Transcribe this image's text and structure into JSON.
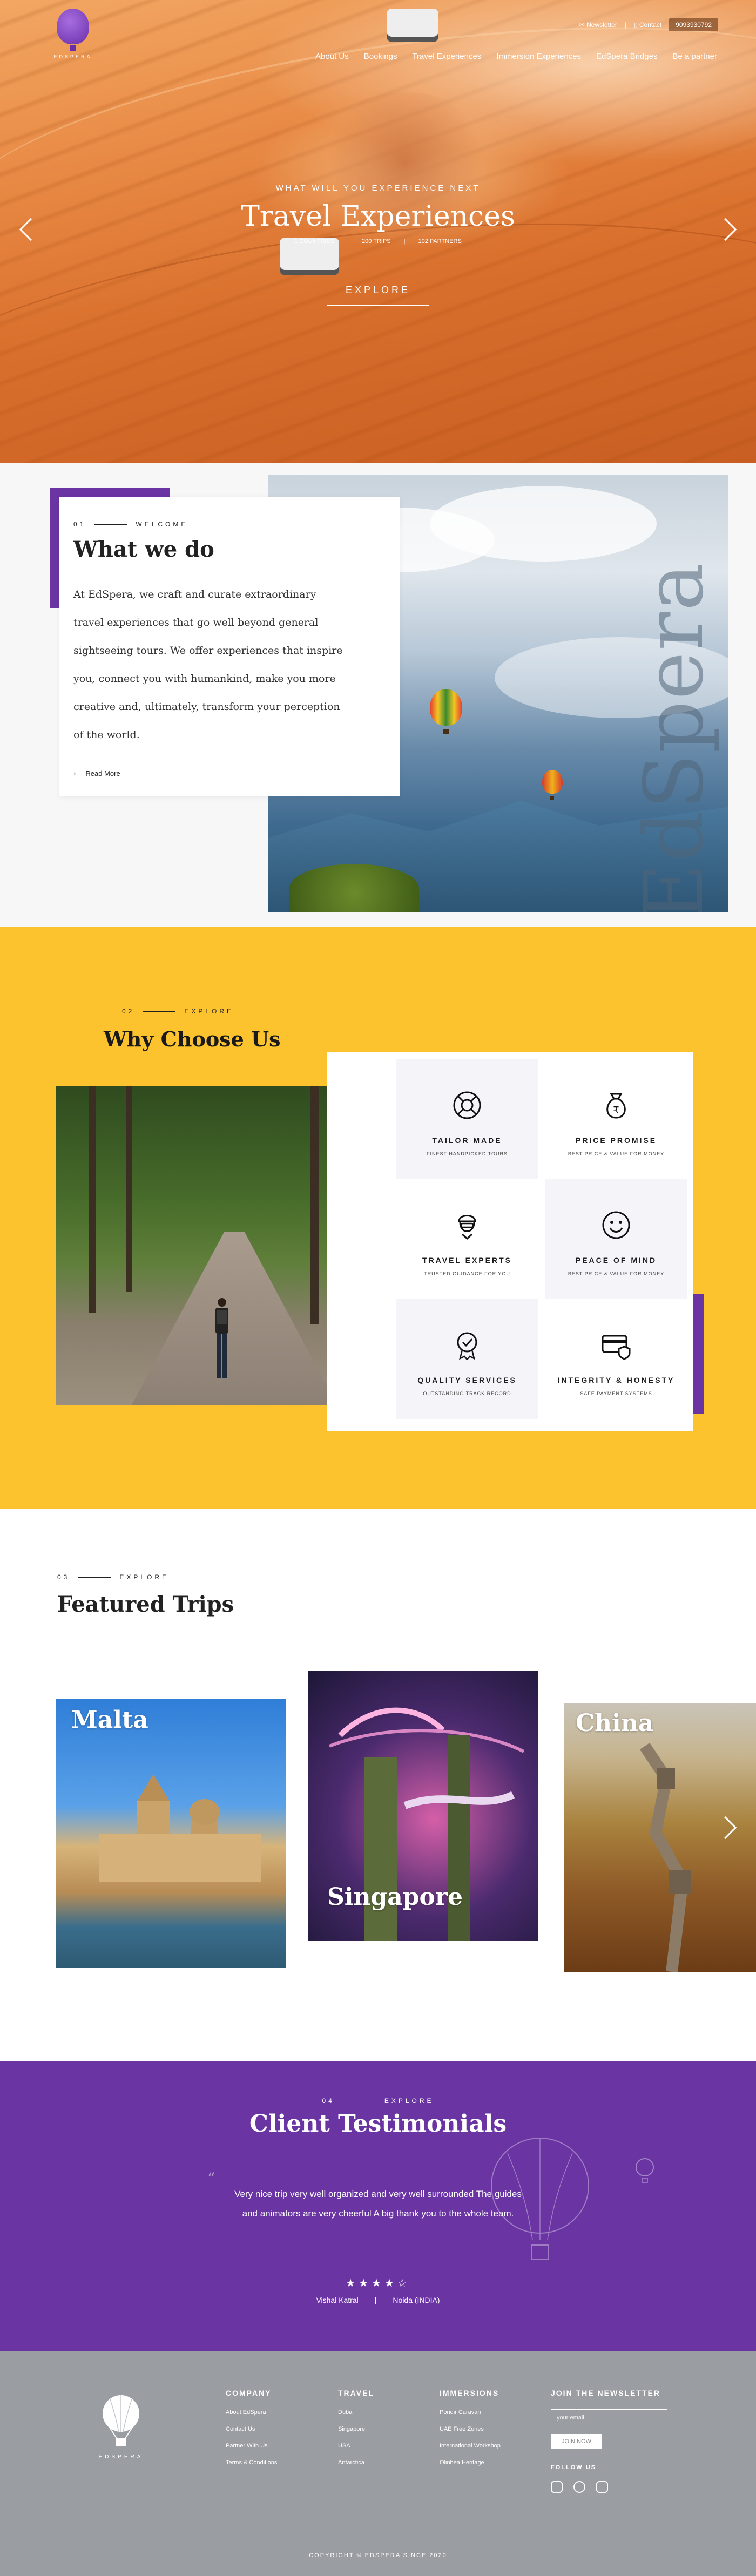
{
  "brand": {
    "name": "EDSPERA",
    "accent": "#6a34a3",
    "yellow": "#fdc32f"
  },
  "header": {
    "newsletter": "Newsletter",
    "contact": "Contact",
    "phone": "9093930792",
    "nav": [
      "About Us",
      "Bookings",
      "Travel Experiences",
      "Immersion Experiences",
      "EdSpera Bridges",
      "Be a partner"
    ]
  },
  "hero": {
    "subtitle": "WHAT WILL YOU EXPERIENCE NEXT",
    "title": "Travel Experiences",
    "stats": [
      "1 COUNTRIES",
      "200 TRIPS",
      "102 PARTNERS"
    ],
    "cta": "EXPLORE"
  },
  "what": {
    "number": "01",
    "eyebrow": "WELCOME",
    "title": "What we do",
    "body": "At EdSpera, we craft and curate extraordinary travel experiences that go well beyond general sightseeing tours. We offer experiences that inspire you, connect you with humankind, make you more creative and, ultimately, transform your perception of the world.",
    "read_more": "Read More",
    "watermark": "EdSpera"
  },
  "why": {
    "number": "02",
    "eyebrow": "EXPLORE",
    "title": "Why Choose Us",
    "features": [
      {
        "title": "TAILOR MADE",
        "sub": "FINEST HANDPICKED TOURS",
        "icon": "lifebuoy-icon"
      },
      {
        "title": "PRICE PROMISE",
        "sub": "BEST PRICE & VALUE FOR MONEY",
        "icon": "rupee-bag-icon"
      },
      {
        "title": "TRAVEL EXPERTS",
        "sub": "TRUSTED GUIDANCE FOR YOU",
        "icon": "pilot-icon"
      },
      {
        "title": "PEACE OF MIND",
        "sub": "BEST PRICE & VALUE FOR MONEY",
        "icon": "smile-icon"
      },
      {
        "title": "QUALITY SERVICES",
        "sub": "OUTSTANDING TRACK RECORD",
        "icon": "medal-icon"
      },
      {
        "title": "INTEGRITY & HONESTY",
        "sub": "SAFE PAYMENT SYSTEMS",
        "icon": "secure-card-icon"
      }
    ]
  },
  "trips": {
    "number": "03",
    "eyebrow": "EXPLORE",
    "title": "Featured Trips",
    "items": [
      "Malta",
      "Singapore",
      "China"
    ]
  },
  "testimonials": {
    "number": "04",
    "eyebrow": "EXPLORE",
    "title": "Client Testimonials",
    "quote": "Very nice trip very well organized and very well surrounded The guides and animators are very cheerful A big thank you to the whole team.",
    "rating": 4,
    "stars": "★★★★☆",
    "author": "Vishal Katral",
    "divider": "|",
    "location": "Noida (INDIA)"
  },
  "footer": {
    "company": {
      "title": "COMPANY",
      "links": [
        "About EdSpera",
        "Contact Us",
        "Partner With Us",
        "Terms & Conditions"
      ]
    },
    "travel": {
      "title": "TRAVEL",
      "links": [
        "Dubai",
        "Singapore",
        "USA",
        "Antarctica"
      ]
    },
    "immersions": {
      "title": "IMMERSIONS",
      "links": [
        "Pondir Caravan",
        "UAE Free Zones",
        "International Workshop",
        "Olinbea Heritage"
      ]
    },
    "newsletter": {
      "title": "JOIN THE NEWSLETTER",
      "placeholder": "your email",
      "button": "JOIN NOW"
    },
    "follow": "FOLLOW US",
    "copyright": "COPYRIGHT © EDSPERA SINCE 2020"
  }
}
